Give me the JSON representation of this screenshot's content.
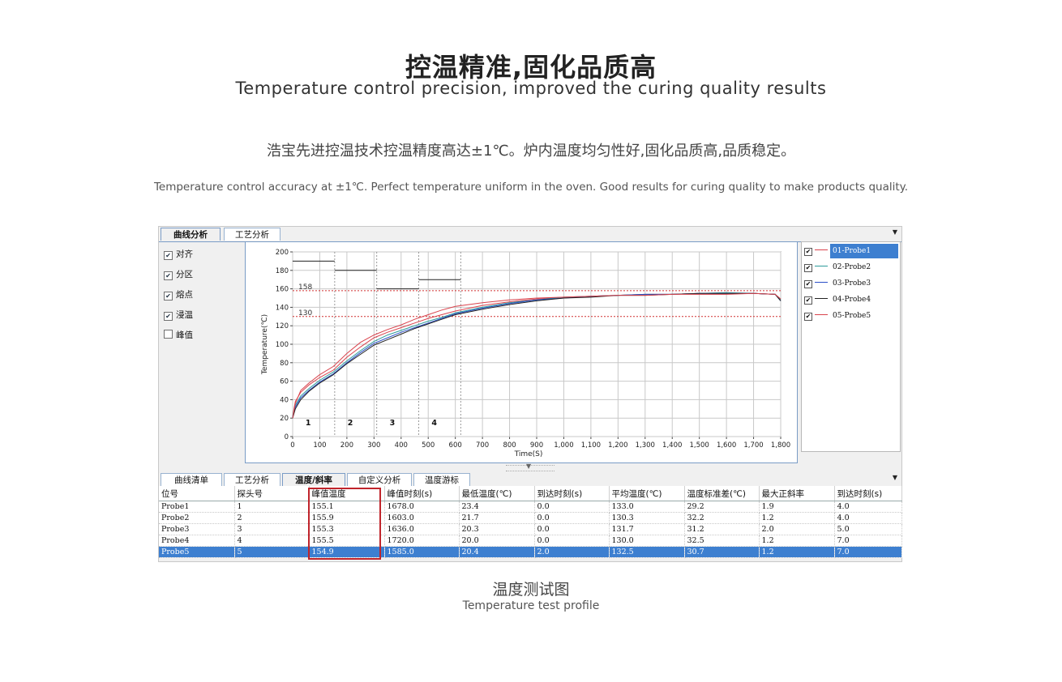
{
  "header": {
    "title": "控温精准,固化品质高",
    "subtitle": "Temperature control precision, improved the curing quality results",
    "desc_cn": "浩宝先进控温技术控温精度高达±1℃。炉内温度均匀性好,固化品质高,品质稳定。",
    "desc_en": "Temperature control accuracy at ±1℃. Perfect temperature uniform in the oven. Good results for curing quality to make products quality."
  },
  "caption": {
    "cn": "温度测试图",
    "en": "Temperature test profile"
  },
  "top_tabs": [
    "曲线分析",
    "工艺分析"
  ],
  "options": [
    {
      "label": "对齐",
      "checked": true
    },
    {
      "label": "分区",
      "checked": true
    },
    {
      "label": "熔点",
      "checked": true
    },
    {
      "label": "浸温",
      "checked": true
    },
    {
      "label": "峰值",
      "checked": false
    }
  ],
  "legend": [
    {
      "label": "01-Probe1",
      "color": "#d9434d",
      "selected": true
    },
    {
      "label": "02-Probe2",
      "color": "#2e9b9b",
      "selected": false
    },
    {
      "label": "03-Probe3",
      "color": "#2b4fc8",
      "selected": false
    },
    {
      "label": "04-Probe4",
      "color": "#222222",
      "selected": false
    },
    {
      "label": "05-Probe5",
      "color": "#d9434d",
      "selected": false
    }
  ],
  "chart_data": {
    "type": "line",
    "xlabel": "Time(S)",
    "ylabel": "Temperature(℃)",
    "xlim": [
      0,
      1800
    ],
    "ylim": [
      0,
      200
    ],
    "xticks": [
      "0",
      "100",
      "200",
      "300",
      "400",
      "500",
      "600",
      "700",
      "800",
      "900",
      "1,000",
      "1,100",
      "1,200",
      "1,300",
      "1,400",
      "1,500",
      "1,600",
      "1,700",
      "1,800"
    ],
    "yticks": [
      "0",
      "20",
      "40",
      "60",
      "80",
      "100",
      "120",
      "140",
      "160",
      "180",
      "200"
    ],
    "grid": true,
    "reference_lines": [
      {
        "label": "158",
        "y": 158
      },
      {
        "label": "130",
        "y": 130
      }
    ],
    "zones": [
      {
        "label": "1",
        "x_start": 0,
        "x_end": 155,
        "setpoint": 190
      },
      {
        "label": "2",
        "x_start": 155,
        "x_end": 310,
        "setpoint": 180
      },
      {
        "label": "3",
        "x_start": 310,
        "x_end": 465,
        "setpoint": 160
      },
      {
        "label": "4",
        "x_start": 465,
        "x_end": 620,
        "setpoint": 170
      }
    ],
    "series": [
      {
        "name": "01-Probe1",
        "color": "#d9434d",
        "x": [
          0,
          10,
          30,
          60,
          100,
          150,
          200,
          250,
          300,
          350,
          400,
          450,
          500,
          550,
          600,
          700,
          800,
          900,
          1000,
          1100,
          1200,
          1300,
          1400,
          1500,
          1600,
          1700,
          1780,
          1800
        ],
        "y": [
          22,
          38,
          48,
          56,
          64,
          72,
          86,
          97,
          107,
          113,
          118,
          123,
          128,
          132,
          136,
          142,
          146,
          149,
          151,
          152,
          153,
          154,
          154,
          155,
          155,
          155,
          154,
          148
        ]
      },
      {
        "name": "02-Probe2",
        "color": "#2e9b9b",
        "x": [
          0,
          10,
          30,
          60,
          100,
          150,
          200,
          250,
          300,
          350,
          400,
          450,
          500,
          550,
          600,
          700,
          800,
          900,
          1000,
          1100,
          1200,
          1300,
          1400,
          1500,
          1600,
          1700,
          1780,
          1800
        ],
        "y": [
          22,
          34,
          44,
          52,
          61,
          70,
          82,
          93,
          103,
          110,
          115,
          120,
          125,
          129,
          134,
          140,
          145,
          148,
          151,
          152,
          153,
          154,
          154,
          155,
          156,
          155,
          154,
          148
        ]
      },
      {
        "name": "03-Probe3",
        "color": "#2b4fc8",
        "x": [
          0,
          10,
          30,
          60,
          100,
          150,
          200,
          250,
          300,
          350,
          400,
          450,
          500,
          550,
          600,
          700,
          800,
          900,
          1000,
          1100,
          1200,
          1300,
          1400,
          1500,
          1600,
          1700,
          1780,
          1800
        ],
        "y": [
          21,
          32,
          42,
          50,
          59,
          68,
          80,
          91,
          101,
          107,
          113,
          118,
          123,
          128,
          133,
          139,
          144,
          148,
          150,
          152,
          153,
          154,
          154,
          155,
          155,
          155,
          154,
          147
        ]
      },
      {
        "name": "04-Probe4",
        "color": "#222222",
        "x": [
          0,
          10,
          30,
          60,
          100,
          150,
          200,
          250,
          300,
          350,
          400,
          450,
          500,
          550,
          600,
          700,
          800,
          900,
          1000,
          1100,
          1200,
          1300,
          1400,
          1500,
          1600,
          1700,
          1780,
          1800
        ],
        "y": [
          20,
          30,
          40,
          49,
          58,
          67,
          79,
          89,
          99,
          105,
          111,
          117,
          122,
          127,
          132,
          138,
          143,
          147,
          150,
          151,
          153,
          153,
          154,
          155,
          155,
          155,
          154,
          147
        ]
      },
      {
        "name": "05-Probe5",
        "color": "#d9434d",
        "x": [
          0,
          10,
          30,
          60,
          100,
          150,
          200,
          250,
          300,
          350,
          400,
          450,
          500,
          550,
          600,
          700,
          800,
          900,
          1000,
          1100,
          1200,
          1300,
          1400,
          1500,
          1600,
          1700,
          1780,
          1800
        ],
        "y": [
          20,
          36,
          50,
          58,
          67,
          76,
          90,
          102,
          110,
          116,
          121,
          127,
          132,
          137,
          141,
          145,
          148,
          150,
          151,
          152,
          153,
          153,
          154,
          154,
          154,
          155,
          154,
          149
        ]
      }
    ]
  },
  "bottom_tabs": [
    "曲线清单",
    "工艺分析",
    "温度/斜率",
    "自定义分析",
    "温度游标"
  ],
  "table": {
    "headers": [
      "位号",
      "探头号",
      "峰值温度",
      "峰值时刻(s)",
      "最低温度(℃)",
      "到达时刻(s)",
      "平均温度(℃)",
      "温度标准差(℃)",
      "最大正斜率",
      "到达时刻(s)"
    ],
    "rows": [
      [
        "Probe1",
        "1",
        "155.1",
        "1678.0",
        "23.4",
        "0.0",
        "133.0",
        "29.2",
        "1.9",
        "4.0"
      ],
      [
        "Probe2",
        "2",
        "155.9",
        "1603.0",
        "21.7",
        "0.0",
        "130.3",
        "32.2",
        "1.2",
        "4.0"
      ],
      [
        "Probe3",
        "3",
        "155.3",
        "1636.0",
        "20.3",
        "0.0",
        "131.7",
        "31.2",
        "2.0",
        "5.0"
      ],
      [
        "Probe4",
        "4",
        "155.5",
        "1720.0",
        "20.0",
        "0.0",
        "130.0",
        "32.5",
        "1.2",
        "7.0"
      ],
      [
        "Probe5",
        "5",
        "154.9",
        "1585.0",
        "20.4",
        "2.0",
        "132.5",
        "30.7",
        "1.2",
        "7.0"
      ]
    ],
    "selected_row": 4
  }
}
